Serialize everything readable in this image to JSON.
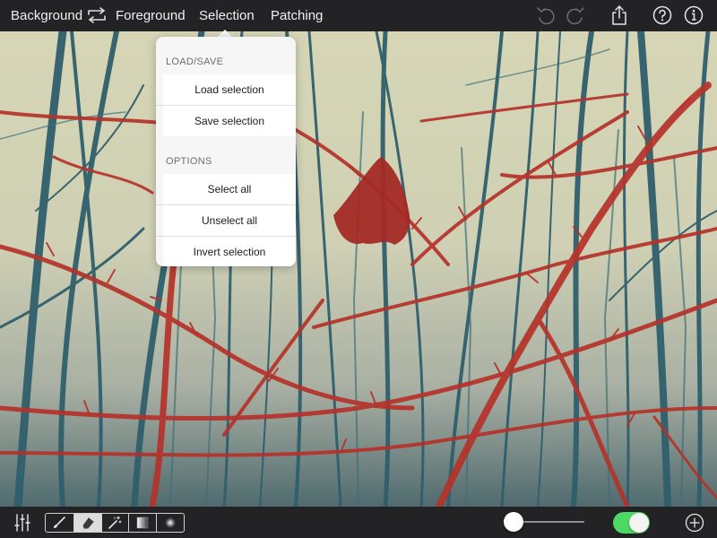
{
  "toolbar": {
    "background_tab": "Background",
    "foreground_tab": "Foreground",
    "selection_tab": "Selection",
    "patching_tab": "Patching",
    "icons": [
      "swap-arrows-icon",
      "undo-icon",
      "redo-icon",
      "share-icon",
      "help-icon",
      "info-icon"
    ]
  },
  "selection_menu": {
    "load_save_header": "LOAD/SAVE",
    "load_selection": "Load selection",
    "save_selection": "Save selection",
    "options_header": "OPTIONS",
    "select_all": "Select all",
    "unselect_all": "Unselect all",
    "invert_selection": "Invert selection"
  },
  "bottom_toolbar": {
    "tools": [
      "brush-icon",
      "eraser-icon",
      "magic-wand-icon",
      "gradient-icon",
      "radial-gradient-icon"
    ],
    "selected_tool": "eraser-icon",
    "brush_size_slider": 0.0,
    "overlay_toggle_on": true,
    "icons": [
      "sliders-icon",
      "add-icon"
    ]
  },
  "colors": {
    "toggle_on": "#4cd964",
    "selection_overlay": "#b5322a"
  }
}
